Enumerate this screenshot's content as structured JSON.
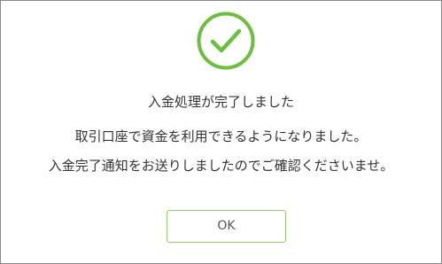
{
  "dialog": {
    "icon": "check-circle-icon",
    "accent_color": "#6bbf3d",
    "title": "入金処理が完了しました",
    "message_line_1": "取引口座で資金を利用できるようになりました。",
    "message_line_2": "入金完了通知をお送りしましたのでご確認くださいませ。",
    "ok_label": "OK"
  }
}
